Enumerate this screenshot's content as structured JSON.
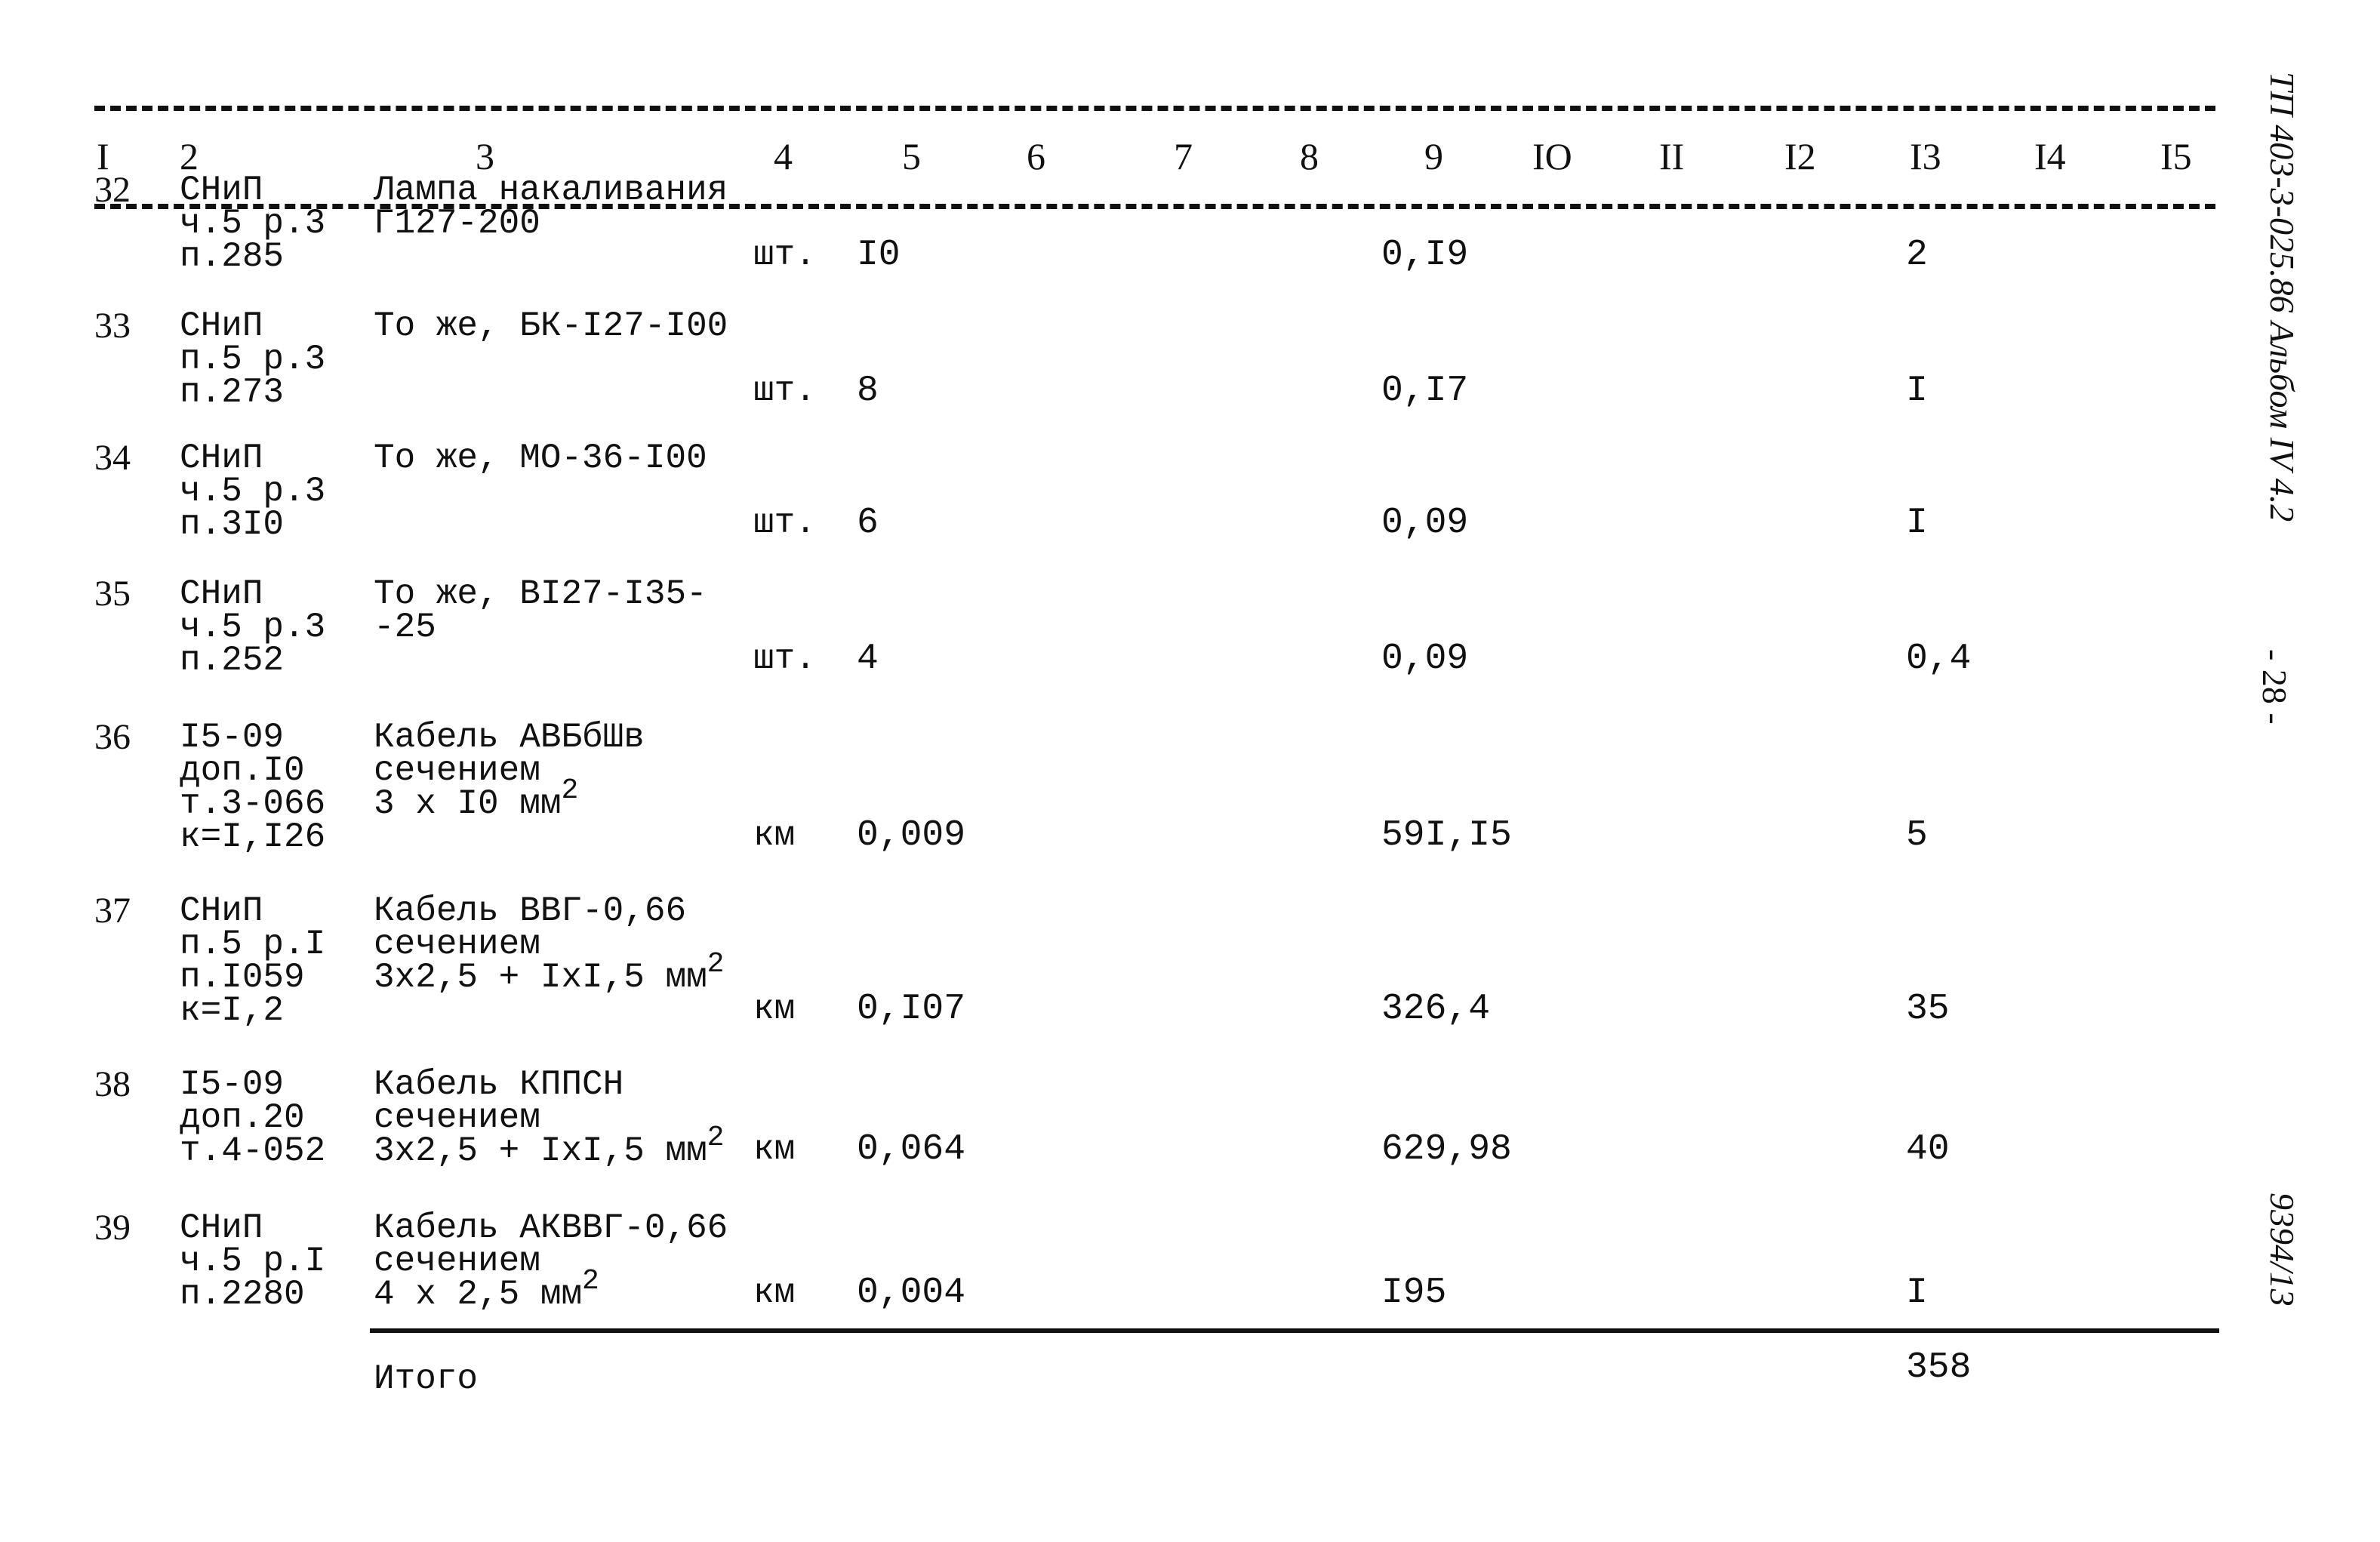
{
  "header": {
    "columns": [
      "I",
      "2",
      "3",
      "4",
      "5",
      "6",
      "7",
      "8",
      "9",
      "IO",
      "II",
      "I2",
      "I3",
      "I4",
      "I5"
    ]
  },
  "rows": [
    {
      "num": "32",
      "ref": [
        "СНиП",
        "ч.5 р.3",
        "п.285"
      ],
      "desc": [
        "Лампа накаливания",
        "Г127-200"
      ],
      "sup": "",
      "unit": "шт.",
      "qty": "I0",
      "c9": "0,I9",
      "c13": "2"
    },
    {
      "num": "33",
      "ref": [
        "СНиП",
        "п.5 р.3",
        "п.273"
      ],
      "desc": [
        "То же, БК-I27-I00"
      ],
      "sup": "",
      "unit": "шт.",
      "qty": "8",
      "c9": "0,I7",
      "c13": "I"
    },
    {
      "num": "34",
      "ref": [
        "СНиП",
        "ч.5 р.3",
        "п.3I0"
      ],
      "desc": [
        "То же, МО-36-I00"
      ],
      "sup": "",
      "unit": "шт.",
      "qty": "6",
      "c9": "0,09",
      "c13": "I"
    },
    {
      "num": "35",
      "ref": [
        "СНиП",
        "ч.5 р.3",
        "п.252"
      ],
      "desc": [
        "То же, BI27-I35-",
        "-25"
      ],
      "sup": "",
      "unit": "шт.",
      "qty": "4",
      "c9": "0,09",
      "c13": "0,4"
    },
    {
      "num": "36",
      "ref": [
        "I5-09",
        "доп.I0",
        "т.3-066",
        "к=I,I26"
      ],
      "desc": [
        "Кабель АВБбШв",
        "сечением",
        "3 х I0 мм"
      ],
      "sup": "2",
      "unit": "км",
      "qty": "0,009",
      "c9": "59I,I5",
      "c13": "5"
    },
    {
      "num": "37",
      "ref": [
        "СНиП",
        "п.5 р.I",
        "п.I059",
        "к=I,2"
      ],
      "desc": [
        "Кабель ВВГ-0,66",
        "сечением",
        "3х2,5 + IхI,5 мм"
      ],
      "sup": "2",
      "unit": "км",
      "qty": "0,I07",
      "c9": "326,4",
      "c13": "35"
    },
    {
      "num": "38",
      "ref": [
        "I5-09",
        "доп.20",
        "т.4-052"
      ],
      "desc": [
        "Кабель КППСН",
        "сечением",
        "3х2,5 + IхI,5 мм"
      ],
      "sup": "2",
      "unit": "км",
      "qty": "0,064",
      "c9": "629,98",
      "c13": "40"
    },
    {
      "num": "39",
      "ref": [
        "СНиП",
        "ч.5 р.I",
        "п.2280"
      ],
      "desc": [
        "Кабель АКВВГ-0,66",
        "сечением",
        "4 х 2,5 мм"
      ],
      "sup": "2",
      "unit": "км",
      "qty": "0,004",
      "c9": "I95",
      "c13": "I"
    }
  ],
  "total": {
    "label": "Итого",
    "c13": "358"
  },
  "margin": {
    "doc_code": "ТП 403-3-025.86 Альбом IV 4.2",
    "page": "- 28 -",
    "inv": "9394/13"
  }
}
